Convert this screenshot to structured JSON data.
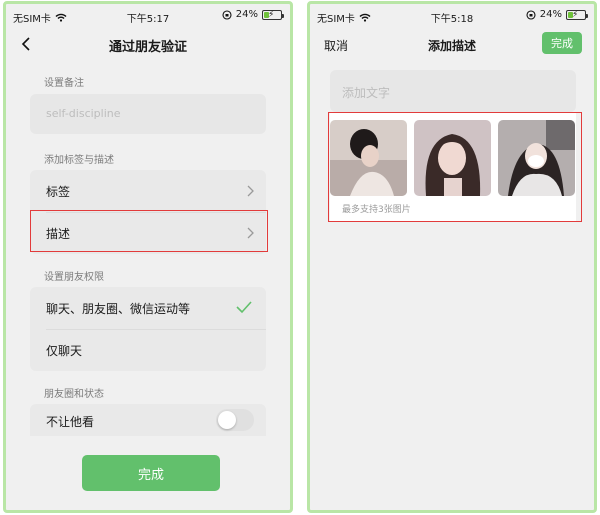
{
  "left": {
    "status": {
      "carrier": "无SIM卡",
      "time": "下午5:17",
      "battery": "24%"
    },
    "title": "通过朋友验证",
    "remark": {
      "label": "设置备注",
      "placeholder": "self-discipline"
    },
    "tags_section": {
      "label": "添加标签与描述",
      "tags": "标签",
      "description": "描述"
    },
    "permission_section": {
      "label": "设置朋友权限",
      "option_all": "聊天、朋友圈、微信运动等",
      "option_chat": "仅聊天"
    },
    "moments_section": {
      "label": "朋友圈和状态",
      "hide_from": "不让他看"
    },
    "done": "完成"
  },
  "right": {
    "status": {
      "carrier": "无SIM卡",
      "time": "下午5:18",
      "battery": "24%"
    },
    "cancel": "取消",
    "title": "添加描述",
    "done": "完成",
    "text_placeholder": "添加文字",
    "photo_limit": "最多支持3张图片",
    "photos": [
      "photo-1",
      "photo-2",
      "photo-3"
    ]
  },
  "colors": {
    "accent_green": "#62c06c",
    "highlight_red": "#e23b3b",
    "frame_green": "#b9e6a6"
  }
}
